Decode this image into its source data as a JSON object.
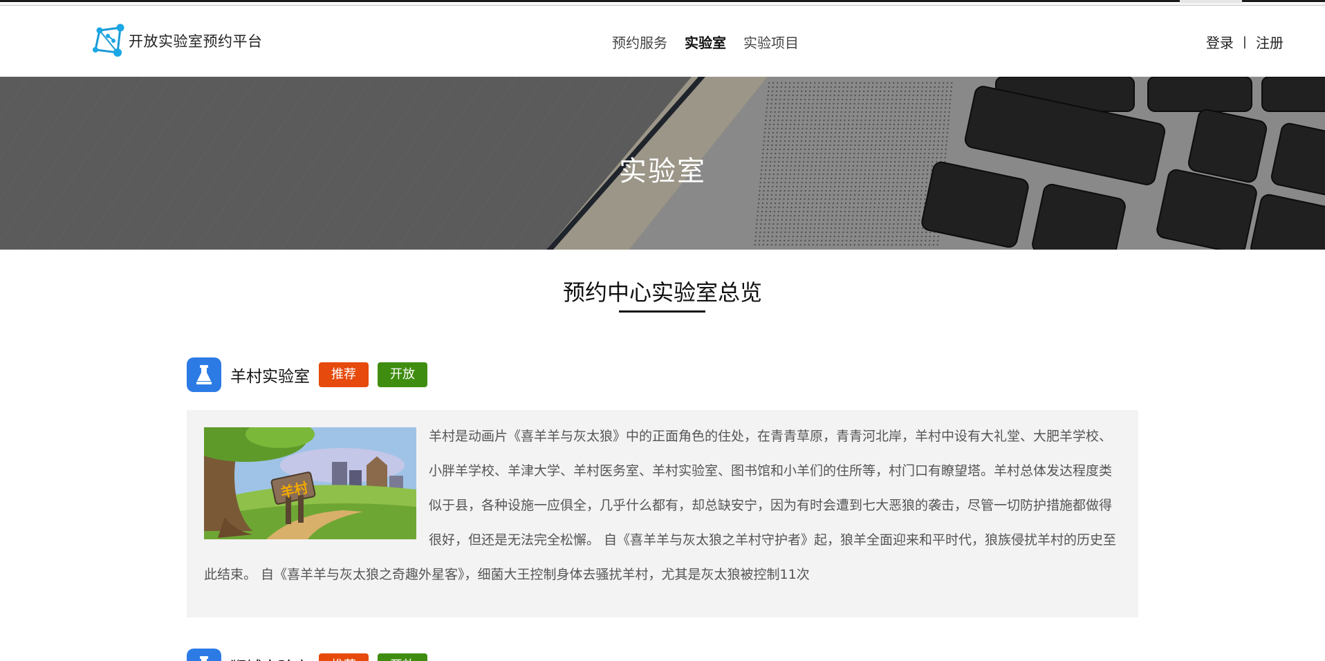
{
  "header": {
    "logo_text": "开放实验室预约平台",
    "nav": [
      {
        "label": "预约服务",
        "active": false
      },
      {
        "label": "实验室",
        "active": true
      },
      {
        "label": "实验项目",
        "active": false
      }
    ],
    "login_label": "登录",
    "separator": "|",
    "register_label": "注册"
  },
  "banner": {
    "title": "实验室"
  },
  "section": {
    "title": "预约中心实验室总览"
  },
  "labs": [
    {
      "name": "羊村实验室",
      "badge_recommend": "推荐",
      "badge_status": "开放",
      "image_sign_text": "羊村",
      "description": "羊村是动画片《喜羊羊与灰太狼》中的正面角色的住处，在青青草原，青青河北岸，羊村中设有大礼堂、大肥羊学校、小胖羊学校、羊津大学、羊村医务室、羊村实验室、图书馆和小羊们的住所等，村门口有瞭望塔。羊村总体发达程度类似于县，各种设施一应俱全，几乎什么都有，却总缺安宁，因为有时会遭到七大恶狼的袭击，尽管一切防护措施都做得很好，但还是无法完全松懈。 自《喜羊羊与灰太狼之羊村守护者》起，狼羊全面迎来和平时代，狼族侵扰羊村的历史至此结束。 自《喜羊羊与灰太狼之奇趣外星客》，细菌大王控制身体去骚扰羊村，尤其是灰太狼被控制11次"
    },
    {
      "name": "狮城实验室",
      "badge_recommend": "推荐",
      "badge_status": "开放"
    }
  ],
  "colors": {
    "brand_blue": "#2c7be5",
    "badge_recommend": "#e64a0c",
    "badge_open": "#3f8d10",
    "card_bg": "#f3f3f3"
  }
}
